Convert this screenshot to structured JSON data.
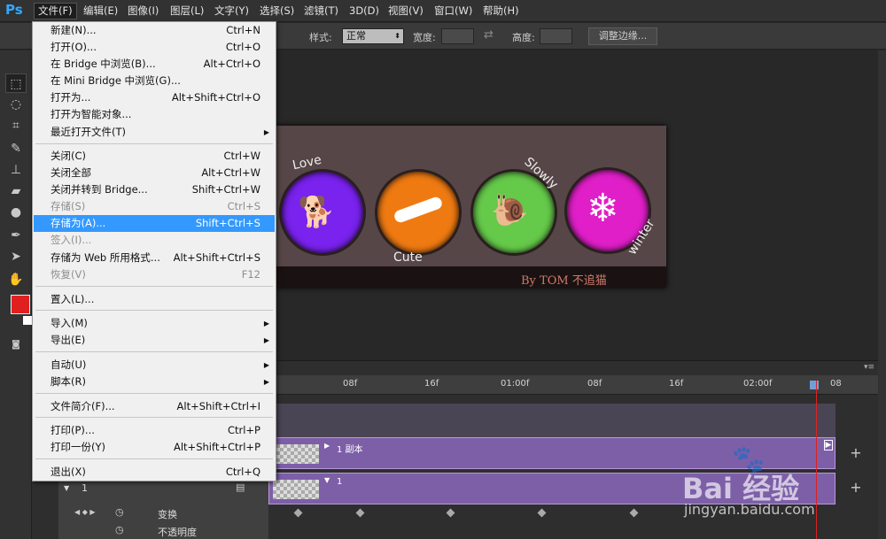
{
  "app": {
    "logo": "Ps"
  },
  "menubar": {
    "items": [
      "文件(F)",
      "编辑(E)",
      "图像(I)",
      "图层(L)",
      "文字(Y)",
      "选择(S)",
      "滤镜(T)",
      "3D(D)",
      "视图(V)",
      "窗口(W)",
      "帮助(H)"
    ]
  },
  "options": {
    "style_label": "样式:",
    "style_value": "正常",
    "width_label": "宽度:",
    "height_label": "高度:",
    "adjust_button": "调整边缘..."
  },
  "file_menu": {
    "items": [
      {
        "label": "新建(N)...",
        "shortcut": "Ctrl+N"
      },
      {
        "label": "打开(O)...",
        "shortcut": "Ctrl+O"
      },
      {
        "label": "在 Bridge 中浏览(B)...",
        "shortcut": "Alt+Ctrl+O"
      },
      {
        "label": "在 Mini Bridge 中浏览(G)...",
        "shortcut": ""
      },
      {
        "label": "打开为...",
        "shortcut": "Alt+Shift+Ctrl+O"
      },
      {
        "label": "打开为智能对象...",
        "shortcut": ""
      },
      {
        "label": "最近打开文件(T)",
        "shortcut": ""
      },
      {
        "label": "关闭(C)",
        "shortcut": "Ctrl+W"
      },
      {
        "label": "关闭全部",
        "shortcut": "Alt+Ctrl+W"
      },
      {
        "label": "关闭并转到 Bridge...",
        "shortcut": "Shift+Ctrl+W"
      },
      {
        "label": "存储(S)",
        "shortcut": "Ctrl+S"
      },
      {
        "label": "存储为(A)...",
        "shortcut": "Shift+Ctrl+S"
      },
      {
        "label": "签入(I)...",
        "shortcut": ""
      },
      {
        "label": "存储为 Web 所用格式...",
        "shortcut": "Alt+Shift+Ctrl+S"
      },
      {
        "label": "恢复(V)",
        "shortcut": "F12"
      },
      {
        "label": "置入(L)...",
        "shortcut": ""
      },
      {
        "label": "导入(M)",
        "shortcut": ""
      },
      {
        "label": "导出(E)",
        "shortcut": ""
      },
      {
        "label": "自动(U)",
        "shortcut": ""
      },
      {
        "label": "脚本(R)",
        "shortcut": ""
      },
      {
        "label": "文件简介(F)...",
        "shortcut": "Alt+Shift+Ctrl+I"
      },
      {
        "label": "打印(P)...",
        "shortcut": "Ctrl+P"
      },
      {
        "label": "打印一份(Y)",
        "shortcut": "Alt+Shift+Ctrl+P"
      },
      {
        "label": "退出(X)",
        "shortcut": "Ctrl+Q"
      }
    ],
    "highlighted": "存储为(A)..."
  },
  "artwork": {
    "words": [
      "Love",
      "Cute",
      "Slowly",
      "winter"
    ],
    "credit": "By  TOM  不追猫",
    "colors": {
      "love": "#7a22ee",
      "cute": "#ef7a12",
      "slowly": "#65c94a",
      "winter": "#e01fc8",
      "background": "#574647"
    }
  },
  "timeline": {
    "ticks": [
      "08f",
      "16f",
      "01:00f",
      "08f",
      "16f",
      "02:00f",
      "08"
    ],
    "tracks": [
      {
        "label": "1 副本"
      },
      {
        "label": "1"
      }
    ],
    "layer_name": "1",
    "properties": [
      "变换",
      "不透明度"
    ]
  },
  "watermark": {
    "brand": "Bai 经验",
    "url": "jingyan.baidu.com"
  }
}
